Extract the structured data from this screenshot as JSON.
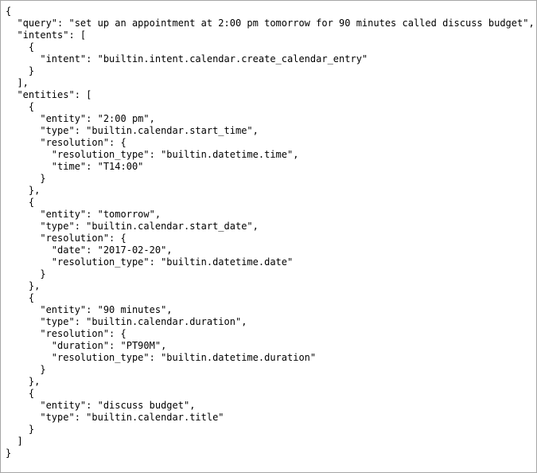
{
  "json_viewer": {
    "lines": [
      "{",
      "  \"query\": \"set up an appointment at 2:00 pm tomorrow for 90 minutes called discuss budget\",",
      "  \"intents\": [",
      "    {",
      "      \"intent\": \"builtin.intent.calendar.create_calendar_entry\"",
      "    }",
      "  ],",
      "  \"entities\": [",
      "    {",
      "      \"entity\": \"2:00 pm\",",
      "      \"type\": \"builtin.calendar.start_time\",",
      "      \"resolution\": {",
      "        \"resolution_type\": \"builtin.datetime.time\",",
      "        \"time\": \"T14:00\"",
      "      }",
      "    },",
      "    {",
      "      \"entity\": \"tomorrow\",",
      "      \"type\": \"builtin.calendar.start_date\",",
      "      \"resolution\": {",
      "        \"date\": \"2017-02-20\",",
      "        \"resolution_type\": \"builtin.datetime.date\"",
      "      }",
      "    },",
      "    {",
      "      \"entity\": \"90 minutes\",",
      "      \"type\": \"builtin.calendar.duration\",",
      "      \"resolution\": {",
      "        \"duration\": \"PT90M\",",
      "        \"resolution_type\": \"builtin.datetime.duration\"",
      "      }",
      "    },",
      "    {",
      "      \"entity\": \"discuss budget\",",
      "      \"type\": \"builtin.calendar.title\"",
      "    }",
      "  ]",
      "}"
    ]
  }
}
